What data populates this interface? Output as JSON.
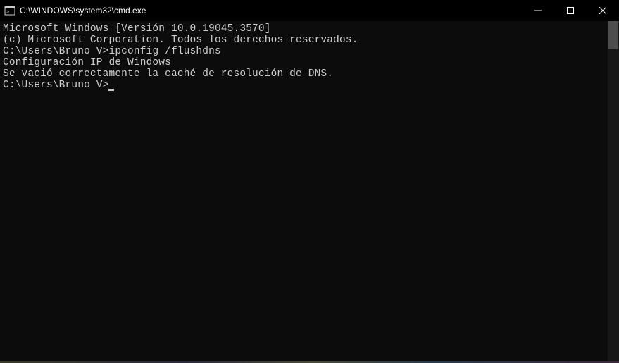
{
  "titlebar": {
    "title": "C:\\WINDOWS\\system32\\cmd.exe"
  },
  "terminal": {
    "line1": "Microsoft Windows [Versión 10.0.19045.3570]",
    "line2": "(c) Microsoft Corporation. Todos los derechos reservados.",
    "blank1": "",
    "prompt1": "C:\\Users\\Bruno V>",
    "command1": "ipconfig /flushdns",
    "blank2": "",
    "output1": "Configuración IP de Windows",
    "blank3": "",
    "output2": "Se vació correctamente la caché de resolución de DNS.",
    "blank4": "",
    "prompt2": "C:\\Users\\Bruno V>"
  }
}
